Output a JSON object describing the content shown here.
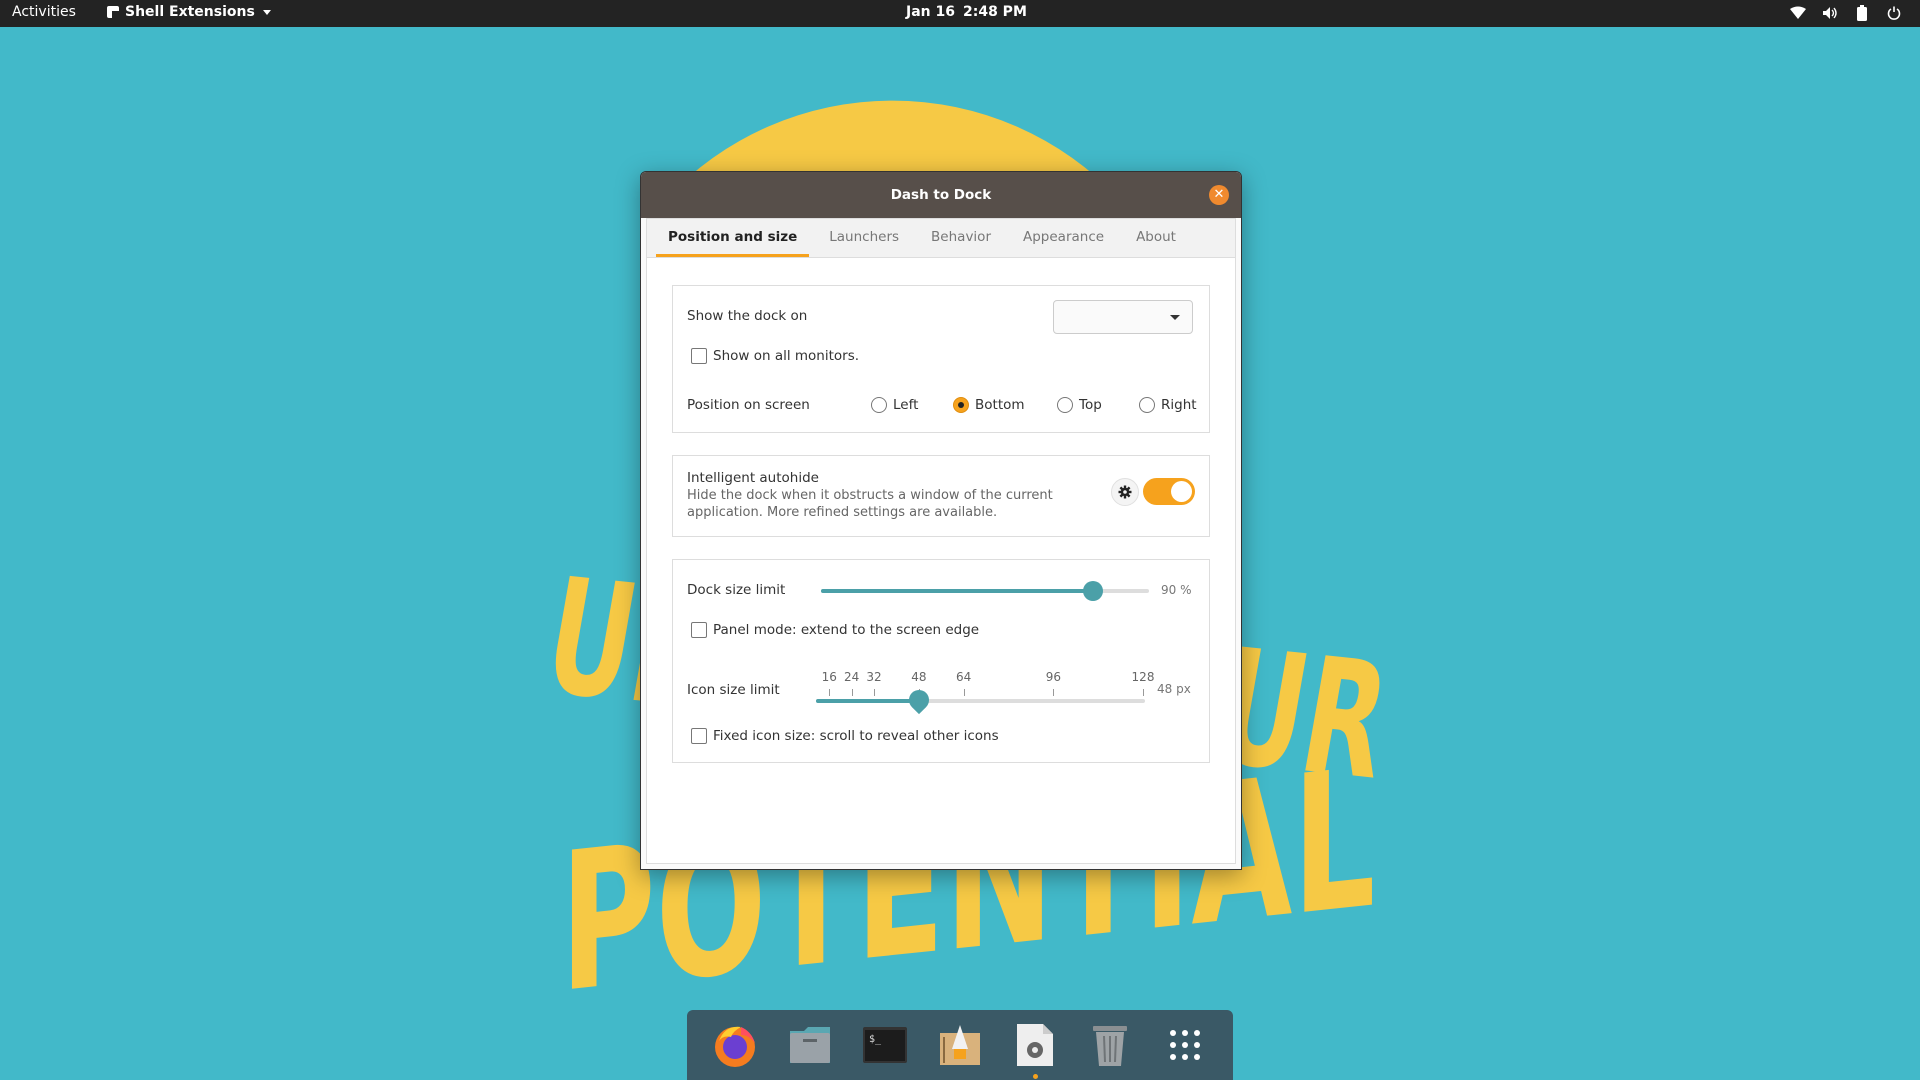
{
  "topbar": {
    "activities": "Activities",
    "app_menu": "Shell Extensions",
    "date": "Jan 16",
    "time": "2:48 PM",
    "status_icons": [
      "wifi-icon",
      "volume-icon",
      "battery-icon",
      "power-icon"
    ]
  },
  "window": {
    "title": "Dash to Dock",
    "close_icon": "close-icon",
    "tabs": [
      {
        "label": "Position and size",
        "active": true
      },
      {
        "label": "Launchers",
        "active": false
      },
      {
        "label": "Behavior",
        "active": false
      },
      {
        "label": "Appearance",
        "active": false
      },
      {
        "label": "About",
        "active": false
      }
    ],
    "position": {
      "show_dock_on_label": "Show the dock on",
      "show_dock_on_value": "",
      "all_monitors_label": "Show on all monitors.",
      "all_monitors_checked": false,
      "position_label": "Position on screen",
      "options": [
        {
          "label": "Left",
          "selected": false
        },
        {
          "label": "Bottom",
          "selected": true
        },
        {
          "label": "Top",
          "selected": false
        },
        {
          "label": "Right",
          "selected": false
        }
      ]
    },
    "autohide": {
      "title": "Intelligent autohide",
      "desc_line1": "Hide the dock when it obstructs a window of the current",
      "desc_line2": "application. More refined settings are available.",
      "enabled": true,
      "settings_icon": "gear-icon"
    },
    "size": {
      "dock_size_label": "Dock size limit",
      "dock_size_value": 90,
      "dock_size_text": "90 %",
      "panel_mode_label": "Panel mode: extend to the screen edge",
      "panel_mode_checked": false,
      "icon_size_label": "Icon size limit",
      "icon_size_marks": [
        "16",
        "24",
        "32",
        "48",
        "64",
        "96",
        "128"
      ],
      "icon_size_value": 48,
      "icon_size_text": "48 px",
      "fixed_icon_label": "Fixed icon size: scroll to reveal other icons",
      "fixed_icon_checked": false
    }
  },
  "dock": {
    "items": [
      {
        "name": "firefox-icon",
        "running": false
      },
      {
        "name": "files-icon",
        "running": false
      },
      {
        "name": "terminal-icon",
        "running": false
      },
      {
        "name": "pop-shop-icon",
        "running": false
      },
      {
        "name": "extension-settings-icon",
        "running": true
      },
      {
        "name": "trash-icon",
        "running": false
      },
      {
        "name": "app-grid-icon",
        "running": false
      }
    ]
  },
  "wallpaper": {
    "text_line1": "UNLOCK YOUR",
    "text_line2": "POTENTIAL",
    "colors": {
      "background": "#42b9c9",
      "accent": "#f6c945"
    }
  },
  "colors": {
    "accent": "#f6a21d",
    "slider": "#4ba0a8",
    "titlebar": "#574f4a",
    "dock": "#3a5966",
    "topbar": "#232323"
  }
}
